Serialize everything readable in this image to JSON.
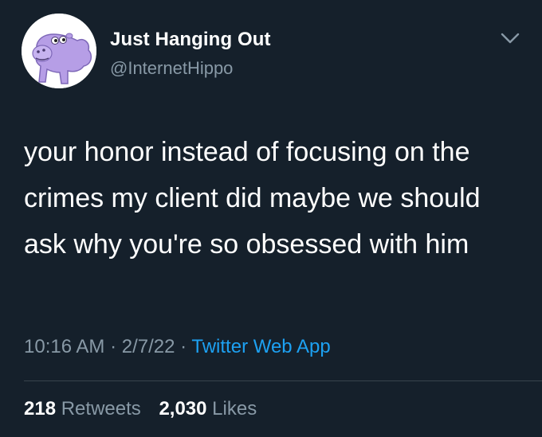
{
  "tweet": {
    "display_name": "Just Hanging Out",
    "handle": "@InternetHippo",
    "text": "your honor instead of focusing on the crimes my client did maybe we should ask why you're so obsessed with him",
    "time": "10:16 AM",
    "separator": "·",
    "date": "2/7/22",
    "source": "Twitter Web App",
    "retweets_count": "218",
    "retweets_label": "Retweets",
    "likes_count": "2,030",
    "likes_label": "Likes"
  },
  "icons": {
    "avatar": "purple-hippo-avatar",
    "menu": "chevron-down-icon"
  },
  "colors": {
    "background": "#15202b",
    "text_primary": "#ffffff",
    "text_secondary": "#8899a6",
    "link": "#1da1f2",
    "divider": "#38444d",
    "hippo": "#b69ee6"
  }
}
